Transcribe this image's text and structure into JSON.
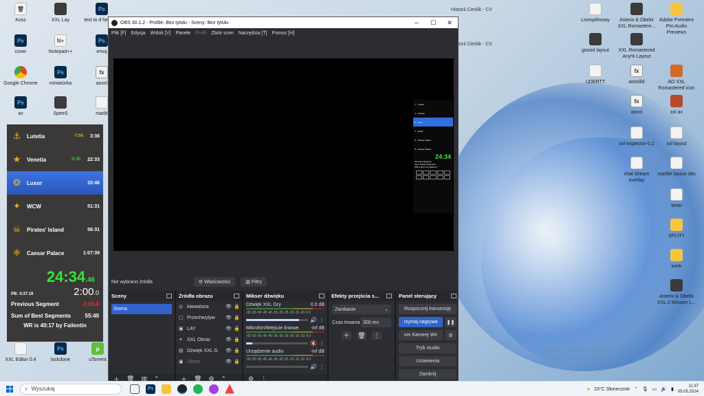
{
  "desktop": {
    "icons_left": [
      {
        "label": "Kosz",
        "kind": "file"
      },
      {
        "label": "XXL Lay",
        "kind": "img"
      },
      {
        "label": "text to d helmety",
        "kind": "ps"
      },
      {
        "label": "cover",
        "kind": "ps"
      },
      {
        "label": "Notepad++",
        "kind": "file"
      },
      {
        "label": "emoj",
        "kind": "ps"
      },
      {
        "label": "Google Chrome",
        "kind": "chrome"
      },
      {
        "label": "miniatúrka",
        "kind": "ps"
      },
      {
        "label": "aoxxl",
        "kind": "fx"
      },
      {
        "label": "av",
        "kind": "ps"
      },
      {
        "label": "SpeeS",
        "kind": "img"
      },
      {
        "label": "marbl",
        "kind": "file"
      },
      {
        "label": "XXL Editor 0.4",
        "kind": "file"
      },
      {
        "label": "lockdone",
        "kind": "ps"
      },
      {
        "label": "uTorrent",
        "kind": "file"
      }
    ],
    "icons_right": [
      {
        "label": "Livesplitnowy",
        "kind": "file"
      },
      {
        "label": "Asterix & Obelix XXL Romastere...",
        "kind": "img"
      },
      {
        "label": "Adobe Premiere Pro Audio Previews",
        "kind": "folder"
      },
      {
        "label": "goood layout",
        "kind": "img"
      },
      {
        "label": "XXL Romastered Any% Layout",
        "kind": "img"
      },
      {
        "label": "UDERTT",
        "kind": "file"
      },
      {
        "label": "aoxxllid",
        "kind": "fx"
      },
      {
        "label": "AO XXL Romastered icon",
        "kind": "img"
      },
      {
        "label": "aoxxl",
        "kind": "fx"
      },
      {
        "label": "xxl av",
        "kind": "img"
      },
      {
        "label": "xxl-inspector-0.2",
        "kind": "file"
      },
      {
        "label": "xxl layout",
        "kind": "img"
      },
      {
        "label": "chat stream overlay",
        "kind": "file"
      },
      {
        "label": "marble layout obs",
        "kind": "file"
      },
      {
        "label": "timer",
        "kind": "file"
      },
      {
        "label": "SPLITY",
        "kind": "folder"
      },
      {
        "label": "work",
        "kind": "folder"
      },
      {
        "label": "Asterix & Obelix XXL 2 Mission L...",
        "kind": "img"
      }
    ],
    "hidden_labels": [
      "Historii Cieślik - CV",
      "Historii Cieślik - CV"
    ],
    "watermark_lines": [
      "Aktywuj system Windows",
      "Przejdź do Ustawień..."
    ]
  },
  "obs": {
    "title": "OBS 30.1.2 - Profile: Bez tytułu - Sceny: Bez tytułu",
    "menu": [
      "Plik [F]",
      "Edycja",
      "Widok [V]",
      "Panele",
      "Profil",
      "Zbiór scen",
      "Narzędzia [T]",
      "Pomoc [H]"
    ],
    "no_source": "Nie wybrano źródła",
    "properties_btn": "Właściwości",
    "filters_btn": "Filtry",
    "docks": {
      "scenes_title": "Sceny",
      "sources_title": "Źródła obrazu",
      "mixer_title": "Mikser dźwięku",
      "transitions_title": "Efekty przejścia s...",
      "controls_title": "Panel sterujący"
    },
    "scenes": [
      "Scena"
    ],
    "sources": [
      {
        "name": "klawiatura",
        "icon": "◎",
        "dim": false
      },
      {
        "name": "Przechwytyw",
        "icon": "▢",
        "dim": false
      },
      {
        "name": "LAY",
        "icon": "▣",
        "dim": false
      },
      {
        "name": "XXL Obraz",
        "icon": "⚭",
        "dim": false
      },
      {
        "name": "Dźwięk XXL G",
        "icon": "▤",
        "dim": false
      },
      {
        "name": "Obraz",
        "icon": "▣",
        "dim": true
      }
    ],
    "mixer": [
      {
        "name": "Dźwięk XXL Gry",
        "db": "0.0 dB",
        "level": 0.85,
        "muted": false
      },
      {
        "name": "Mikrofon/Wejście liniowe",
        "db": "-inf dB",
        "level": 0.1,
        "muted": true
      },
      {
        "name": "Urządzenie audio",
        "db": "-inf dB",
        "level": 0.0,
        "muted": false
      }
    ],
    "mixer_scale": "-60 -55 -50 -45 -40 -35 -30 -25 -20 -15 -10 -5 0",
    "transition": {
      "select": "Zanikanie",
      "duration_label": "Czas trwania",
      "duration": "300 ms"
    },
    "controls": {
      "stream": "Rozpocznij transmisję",
      "record": "rzymaj nagrywa",
      "vcam": "om Kamerę Wir",
      "studio": "Tryb studia",
      "settings": "Ustawienia",
      "exit": "Zamknij"
    }
  },
  "livesplit": {
    "splits": [
      {
        "name": "Lutetia",
        "delta": "-7:05",
        "delta_color": "#e6b020",
        "time": "3:36",
        "icon": "⚓"
      },
      {
        "name": "Venetia",
        "delta": "-6:35",
        "delta_color": "#33cc33",
        "time": "22:33",
        "icon": "★"
      },
      {
        "name": "Luxor",
        "delta": "",
        "delta_color": "#ffffff",
        "time": "33:46",
        "icon": "❂",
        "selected": true
      },
      {
        "name": "WCW",
        "delta": "",
        "delta_color": "#ffffff",
        "time": "51:31",
        "icon": "✦"
      },
      {
        "name": "Pirates' Island",
        "delta": "",
        "delta_color": "#ffffff",
        "time": "56:31",
        "icon": "☠"
      },
      {
        "name": "Caesar Palace",
        "delta": "",
        "delta_color": "#ffffff",
        "time": "1:07:39",
        "icon": "❈"
      }
    ],
    "timer_main": "24:34",
    "timer_frac": ".46",
    "pb_label": "PB:",
    "pb_value": "4:37.19",
    "segment_time": "2:00",
    "segment_frac": ".0",
    "prev_segment_label": "Previous Segment",
    "prev_segment_value": "-1:03.8",
    "sob_label": "Sum of Best Segments",
    "sob_value": "55:49",
    "wr_text": "WR is 40:17 by Failentin"
  },
  "taskbar": {
    "search": "Wyszukaj",
    "weather": "23°C  Słonecznie",
    "time": "11:37",
    "date": "05.05.2024"
  }
}
